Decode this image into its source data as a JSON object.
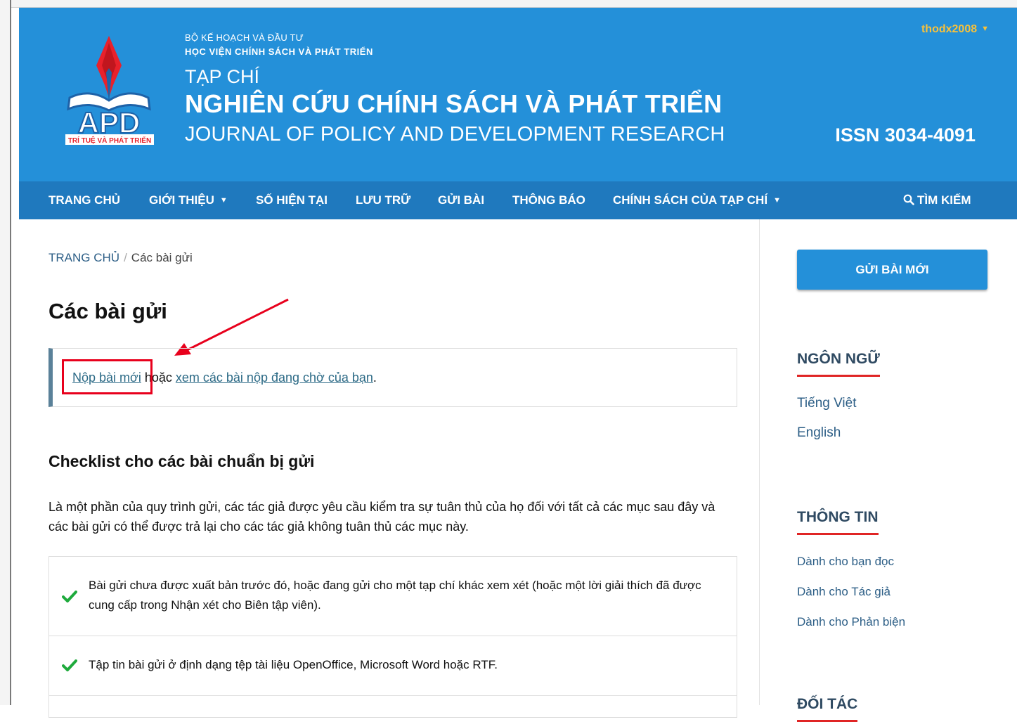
{
  "header": {
    "logo": {
      "letters": "APD",
      "tagline": "TRÍ TUỆ VÀ PHÁT TRIỂN"
    },
    "ministry": "BỘ KẾ HOẠCH VÀ ĐẦU TƯ",
    "academy": "HỌC VIỆN CHÍNH SÁCH VÀ PHÁT TRIỂN",
    "journal_prefix": "TẠP CHÍ",
    "journal_title": "NGHIÊN CỨU CHÍNH SÁCH VÀ PHÁT TRIỂN",
    "journal_english": "JOURNAL OF POLICY AND DEVELOPMENT RESEARCH",
    "issn": "ISSN 3034-4091",
    "username": "thodx2008"
  },
  "nav": {
    "items": [
      {
        "label": "TRANG CHỦ"
      },
      {
        "label": "GIỚI THIỆU"
      },
      {
        "label": "SỐ HIỆN TẠI"
      },
      {
        "label": "LƯU TRỮ"
      },
      {
        "label": "GỬI BÀI"
      },
      {
        "label": "THÔNG BÁO"
      },
      {
        "label": "CHÍNH SÁCH CỦA TẠP CHÍ"
      }
    ],
    "search_label": "TÌM KIẾM"
  },
  "breadcrumb": {
    "home": "TRANG CHỦ",
    "separator": "/",
    "current": "Các bài gửi"
  },
  "main": {
    "title": "Các bài gửi",
    "notice": {
      "new_submission_link": "Nộp bài mới",
      "or_text": " hoặc ",
      "pending_link": "xem các bài nộp đang chờ của bạn",
      "end": "."
    },
    "checklist_title": "Checklist cho các bài chuẩn bị gửi",
    "checklist_intro": "Là một phần của quy trình gửi, các tác giả được yêu cầu kiểm tra sự tuân thủ của họ đối với tất cả các mục sau đây và các bài gửi có thể được trả lại cho các tác giả không tuân thủ các mục này.",
    "checklist_items": [
      "Bài gửi chưa được xuất bản trước đó, hoặc đang gửi cho một tạp chí khác xem xét (hoặc một lời giải thích đã được cung cấp trong Nhận xét cho Biên tập viên).",
      "Tập tin bài gửi ở định dạng tệp tài liệu OpenOffice, Microsoft Word hoặc RTF."
    ]
  },
  "sidebar": {
    "submit_button": "GỬI BÀI MỚI",
    "language_title": "NGÔN NGỮ",
    "languages": [
      "Tiếng Việt",
      "English"
    ],
    "info_title": "THÔNG TIN",
    "info_links": [
      "Dành cho bạn đọc",
      "Dành cho Tác giả",
      "Dành cho Phản biện"
    ],
    "partners_title": "ĐỐI TÁC"
  },
  "colors": {
    "header_blue": "#2490d9",
    "nav_blue": "#1f79be",
    "username_gold": "#f7c13b",
    "annotation_red": "#e8001c",
    "check_green": "#1eaa3c"
  }
}
